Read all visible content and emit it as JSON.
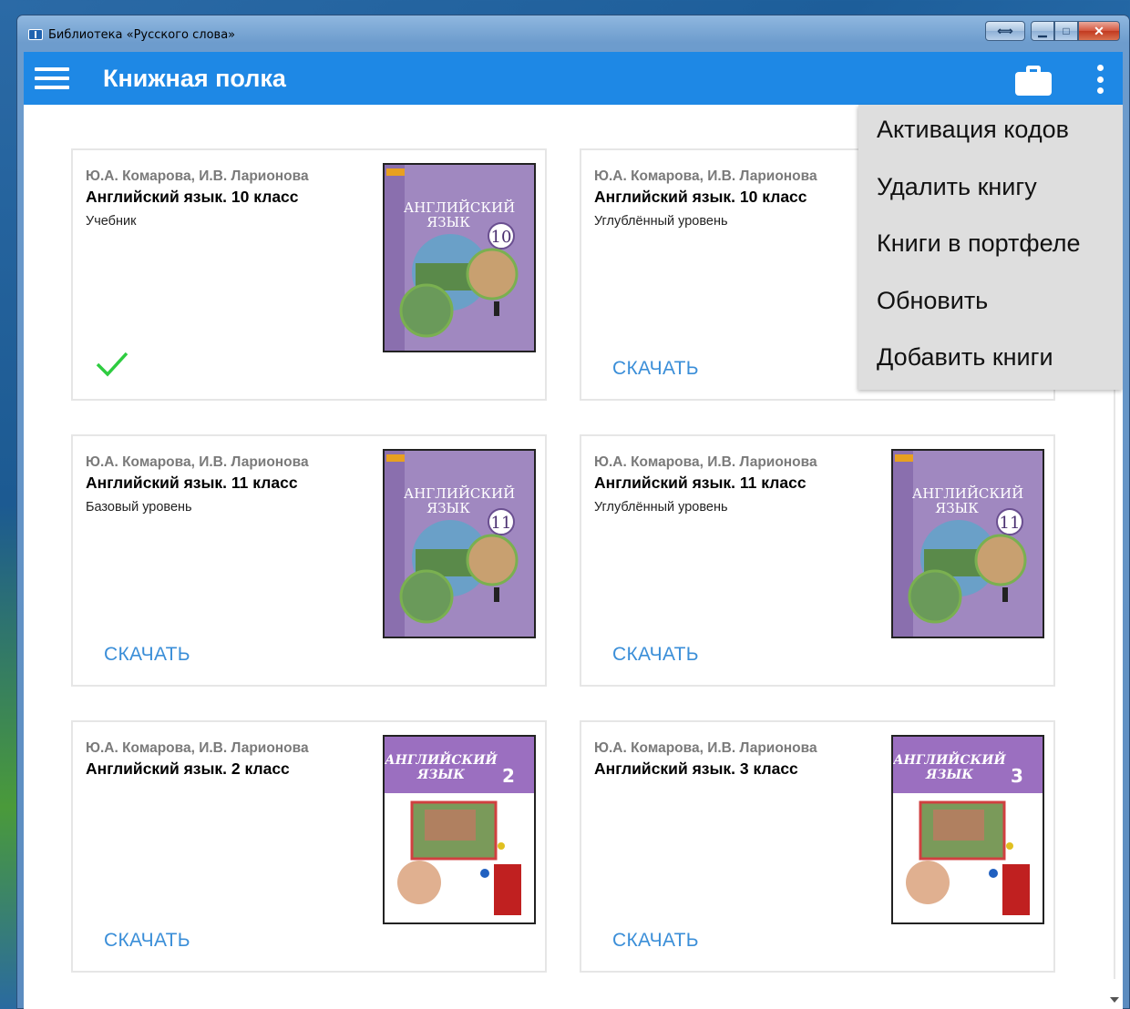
{
  "window": {
    "title": "Библиотека «Русского слова»",
    "resize_glyph": "⟺",
    "min_glyph": "▁",
    "max_glyph": "□",
    "close_glyph": "✕"
  },
  "appbar": {
    "title": "Книжная полка",
    "menu_icon": "hamburger-icon",
    "briefcase_icon": "briefcase-icon",
    "more_icon": "more-vert-icon",
    "color": "#1e88e5"
  },
  "menu": {
    "items": [
      {
        "label": "Активация кодов"
      },
      {
        "label": "Удалить книгу"
      },
      {
        "label": "Книги в портфеле"
      },
      {
        "label": "Обновить"
      },
      {
        "label": "Добавить книги"
      }
    ]
  },
  "books": [
    {
      "authors": "Ю.А. Комарова, И.В. Ларионова",
      "title": "Английский язык. 10 класс",
      "subtitle": "Учебник",
      "downloaded": true,
      "action": "",
      "cover_number": "10",
      "cover_title": "АНГЛИЙСКИЙ",
      "cover_title2": "ЯЗЫК"
    },
    {
      "authors": "Ю.А. Комарова, И.В. Ларионова",
      "title": "Английский язык. 10 класс",
      "subtitle": "Углублённый уровень",
      "downloaded": false,
      "action": "СКАЧАТЬ",
      "cover_number": "10",
      "cover_title": "АНГЛИЙСКИЙ",
      "cover_title2": "ЯЗЫК"
    },
    {
      "authors": "Ю.А. Комарова, И.В. Ларионова",
      "title": "Английский язык. 11 класс",
      "subtitle": "Базовый уровень",
      "downloaded": false,
      "action": "СКАЧАТЬ",
      "cover_number": "11",
      "cover_title": "АНГЛИЙСКИЙ",
      "cover_title2": "ЯЗЫК"
    },
    {
      "authors": "Ю.А. Комарова, И.В. Ларионова",
      "title": "Английский язык. 11 класс",
      "subtitle": "Углублённый уровень",
      "downloaded": false,
      "action": "СКАЧАТЬ",
      "cover_number": "11",
      "cover_title": "АНГЛИЙСКИЙ",
      "cover_title2": "ЯЗЫК"
    },
    {
      "authors": "Ю.А. Комарова, И.В. Ларионова",
      "title": "Английский язык. 2 класс",
      "subtitle": "",
      "downloaded": false,
      "action": "СКАЧАТЬ",
      "cover_number": "2",
      "cover_title": "АНГЛИЙСКИЙ",
      "cover_title2": "ЯЗЫК"
    },
    {
      "authors": "Ю.А. Комарова, И.В. Ларионова",
      "title": "Английский язык. 3 класс",
      "subtitle": "",
      "downloaded": false,
      "action": "СКАЧАТЬ",
      "cover_number": "3",
      "cover_title": "АНГЛИЙСКИЙ",
      "cover_title2": "ЯЗЫК"
    }
  ],
  "colors": {
    "accent_link": "#3a8ed8",
    "check": "#2ecc40",
    "cover_purple": "#9b7bb8"
  }
}
